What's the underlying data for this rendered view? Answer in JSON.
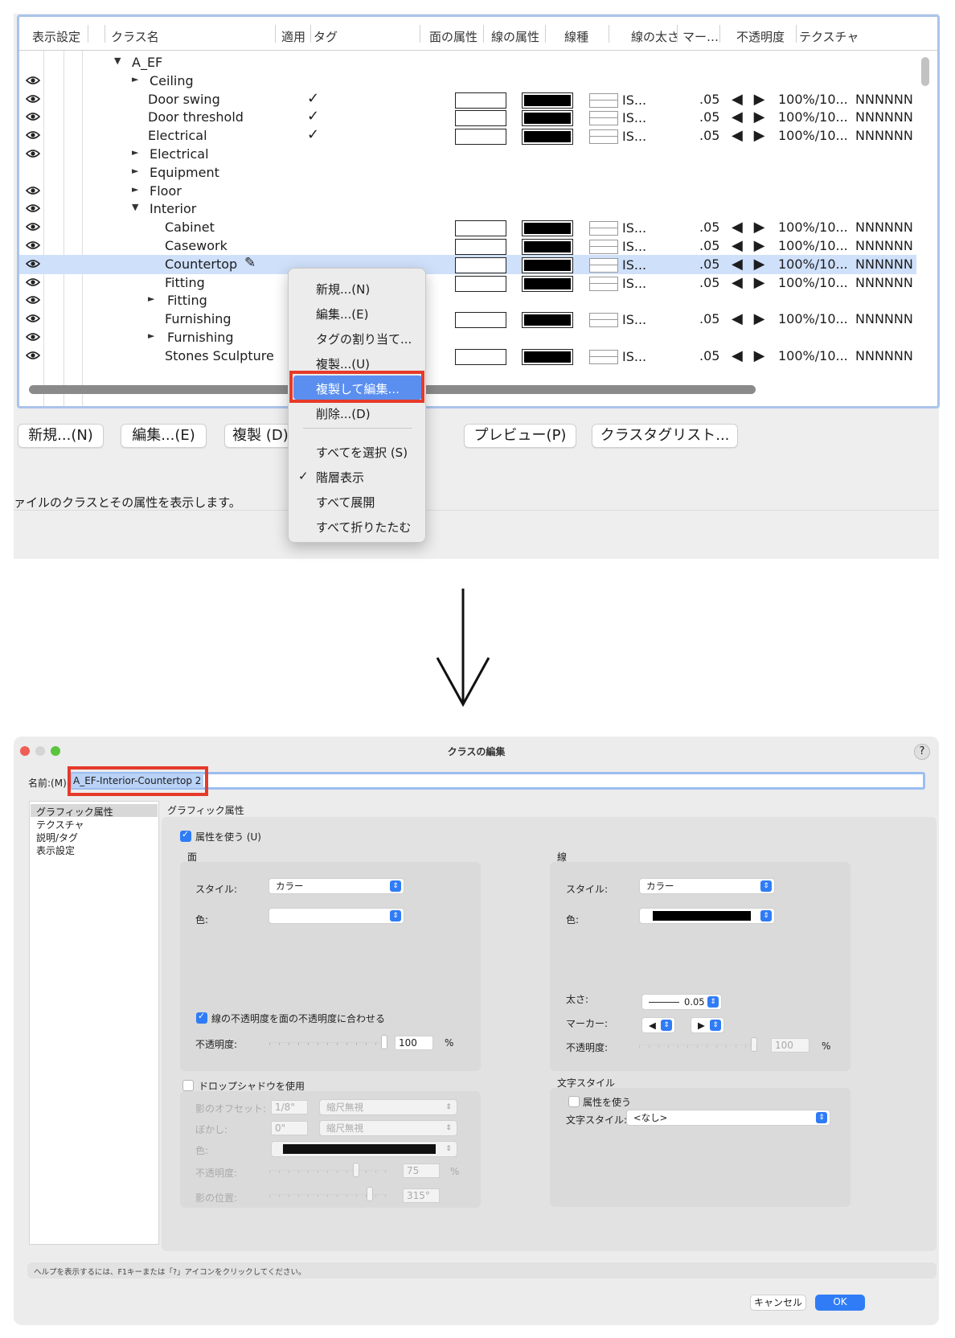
{
  "top": {
    "columns": [
      "表示設定",
      "クラス名",
      "適用",
      "タグ",
      "面の属性",
      "線の属性",
      "線種",
      "線の太さ",
      "マー…",
      "不透明度",
      "テクスチャ"
    ],
    "rows": [
      {
        "name": "A_EF",
        "tri": "▼",
        "eye": false,
        "check": false,
        "attrs": false
      },
      {
        "name": "Ceiling",
        "tri": "►",
        "eye": true,
        "check": false,
        "attrs": false
      },
      {
        "name": "Door swing",
        "tri": "",
        "eye": true,
        "check": true,
        "attrs": true
      },
      {
        "name": "Door threshold",
        "tri": "",
        "eye": true,
        "check": true,
        "attrs": true
      },
      {
        "name": "Electrical",
        "tri": "",
        "eye": true,
        "check": true,
        "attrs": true
      },
      {
        "name": "Electrical",
        "tri": "►",
        "eye": true,
        "check": false,
        "attrs": false
      },
      {
        "name": "Equipment",
        "tri": "►",
        "eye": false,
        "check": false,
        "attrs": false
      },
      {
        "name": "Floor",
        "tri": "►",
        "eye": true,
        "check": false,
        "attrs": false
      },
      {
        "name": "Interior",
        "tri": "▼",
        "eye": true,
        "check": false,
        "attrs": false
      },
      {
        "name": "Cabinet",
        "tri": "",
        "eye": true,
        "check": false,
        "attrs": true
      },
      {
        "name": "Casework",
        "tri": "",
        "eye": true,
        "check": false,
        "attrs": true
      },
      {
        "name": "Countertop",
        "tri": "",
        "eye": true,
        "check": false,
        "attrs": true,
        "selected": true
      },
      {
        "name": "Fitting",
        "tri": "",
        "eye": true,
        "check": false,
        "attrs": true
      },
      {
        "name": "Fitting",
        "tri": "►",
        "eye": true,
        "check": false,
        "attrs": false
      },
      {
        "name": "Furnishing",
        "tri": "",
        "eye": true,
        "check": false,
        "attrs": true
      },
      {
        "name": "Furnishing",
        "tri": "►",
        "eye": true,
        "check": false,
        "attrs": false
      },
      {
        "name": "Stones Sculpture",
        "tri": "",
        "eye": true,
        "check": false,
        "attrs": true
      }
    ],
    "attr_values": {
      "linetype": "IS...",
      "weight": ".05",
      "marker": "◀ ▶",
      "opacity": "100%/10...",
      "texture": "NNNNNN"
    },
    "buttons": {
      "new": "新規...(N)",
      "edit": "編集...(E)",
      "dup": "複製 (D)",
      "preview": "プレビュー(P)",
      "taglist": "クラスタグリスト..."
    },
    "description": "ァイルのクラスとその属性を表示します。",
    "menu": {
      "items": [
        "新規...(N)",
        "編集...(E)",
        "タグの割り当て...",
        "複製...(U)",
        "複製して編集...",
        "削除...(D)",
        "すべてを選択 (S)",
        "階層表示",
        "すべて展開",
        "すべて折りたたむ"
      ],
      "check": "✓"
    }
  },
  "dialog": {
    "title": "クラスの編集",
    "help": "?",
    "name_label": "名前:(M)",
    "name_value": "A_EF-Interior-Countertop 2",
    "sidebar": [
      "グラフィック属性",
      "テクスチャ",
      "説明/タグ",
      "表示設定"
    ],
    "section_title": "グラフィック属性",
    "use_attrs": "属性を使う (U)",
    "fill": {
      "heading": "面",
      "style_label": "スタイル:",
      "style_value": "カラー",
      "color_label": "色:",
      "match_label": "線の不透明度を面の不透明度に合わせる",
      "opacity_label": "不透明度:",
      "opacity_value": "100",
      "percent": "%"
    },
    "line": {
      "heading": "線",
      "style_label": "スタイル:",
      "style_value": "カラー",
      "color_label": "色:",
      "weight_label": "太さ:",
      "weight_value": "0.05",
      "marker_label": "マーカー:",
      "marker_left": "◀",
      "marker_right": "▶",
      "opacity_label": "不透明度:",
      "opacity_value": "100",
      "percent": "%"
    },
    "shadow": {
      "label": "ドロップシャドウを使用",
      "offset_label": "影のオフセット:",
      "offset_value": "1/8\"",
      "offset_mode": "縮尺無視",
      "blur_label": "ぼかし:",
      "blur_value": "0\"",
      "blur_mode": "縮尺無視",
      "color_label": "色:",
      "opacity_label": "不透明度:",
      "opacity_value": "75",
      "percent": "%",
      "angle_label": "影の位置:",
      "angle_value": "315°"
    },
    "text_style": {
      "heading": "文字スタイル",
      "use_label": "属性を使う",
      "style_label": "文字スタイル:",
      "style_value": "<なし>"
    },
    "help_text": "ヘルプを表示するには、F1キーまたは「?」アイコンをクリックしてください。",
    "cancel": "キャンセル",
    "ok": "OK"
  },
  "colors": {
    "accent": "#2f7cf6",
    "selection": "#cfe0fa",
    "highlight": "#e53a2a"
  }
}
